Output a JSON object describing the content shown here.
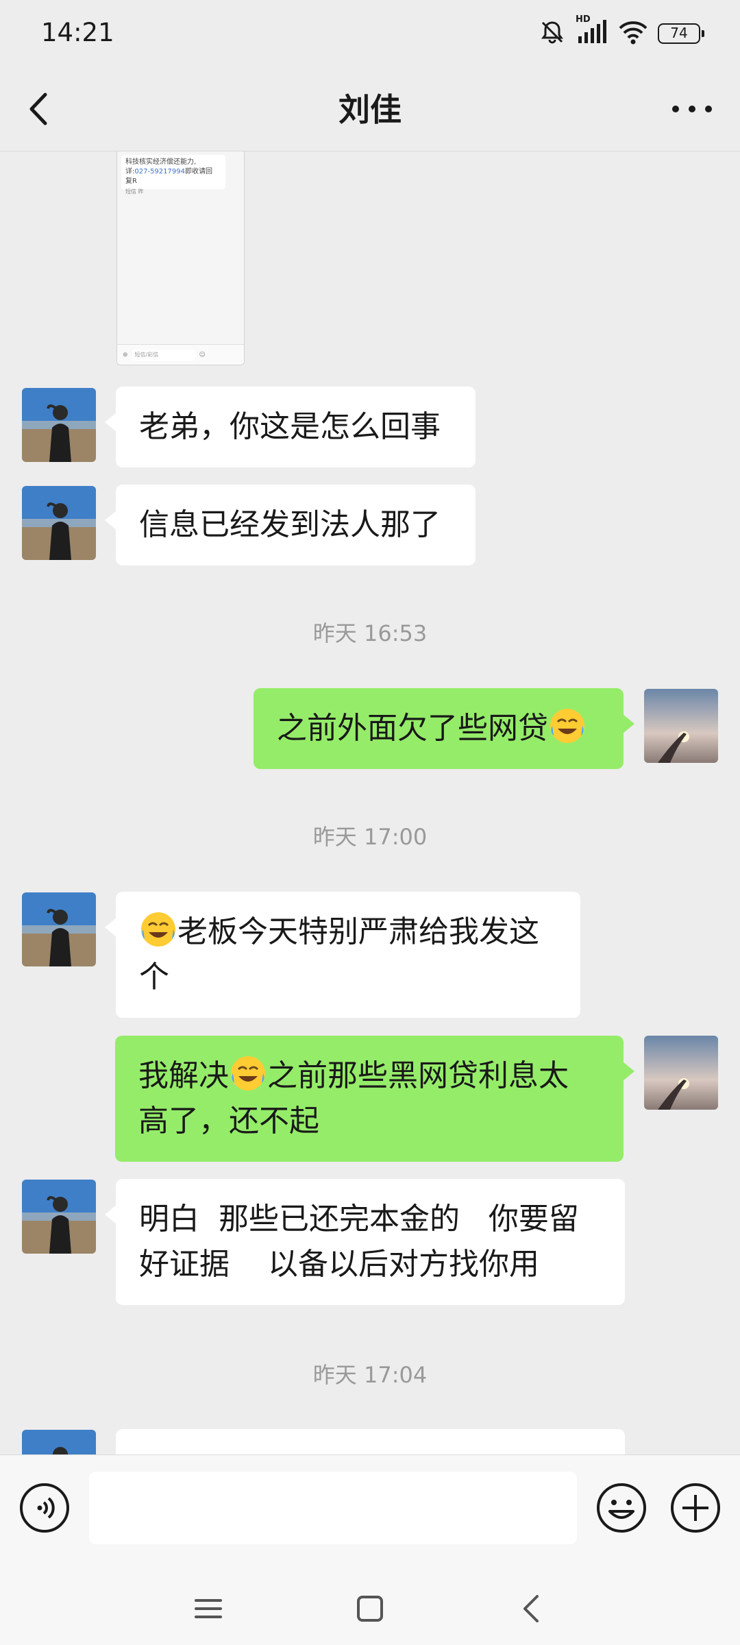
{
  "status_bar": {
    "time": "14:21",
    "battery": "74",
    "network_label": "HD"
  },
  "header": {
    "title": "刘佳"
  },
  "shared_screenshot": {
    "message_line1": "科技核实经济偿还能力,",
    "message_line2": "详:",
    "phone": "027-59217994",
    "message_line3": "即收请回",
    "message_line4": "复R",
    "time": "短信 昨",
    "input_placeholder": "短信/彩信"
  },
  "messages": [
    {
      "side": "left",
      "text": "老弟，你这是怎么回事"
    },
    {
      "side": "left",
      "text": "信息已经发到法人那了"
    },
    {
      "type": "time",
      "text": "昨天 16:53"
    },
    {
      "side": "right",
      "text_before": "之前外面欠了些网贷",
      "emoji": "laughing-crying-emoji"
    },
    {
      "type": "time",
      "text": "昨天 17:00"
    },
    {
      "side": "left",
      "emoji": "laughing-crying-emoji",
      "text_after_line1": "老板今天特别严肃给我发这",
      "text_after_line2": "个"
    },
    {
      "side": "right",
      "text_before": "我解决",
      "emoji": "laughing-crying-emoji",
      "text_after_line1": "之前那些黑网贷利息太",
      "text_after_line2": "高了，还不起"
    },
    {
      "side": "left",
      "line1": "明白  那些已还完本金的   你要留",
      "line2": "好证据    以备以后对方找你用"
    },
    {
      "type": "time",
      "text": "昨天 17:04"
    }
  ],
  "input_bar": {
    "value": "",
    "placeholder": ""
  },
  "colors": {
    "background": "#ededed",
    "sent_bubble": "#95ec69",
    "received_bubble": "#ffffff",
    "timestamp": "#999999"
  }
}
